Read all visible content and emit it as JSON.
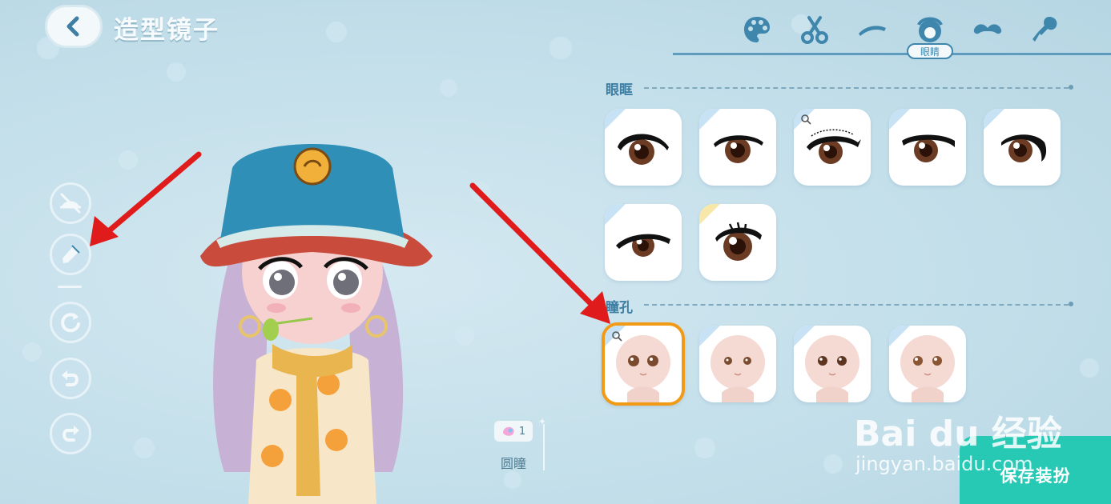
{
  "header": {
    "title": "造型镜子",
    "back_icon": "chevron-left-icon"
  },
  "tabs": {
    "items": [
      {
        "icon": "palette-icon"
      },
      {
        "icon": "scissors-icon"
      },
      {
        "icon": "eyebrow-icon"
      },
      {
        "icon": "eye-icon",
        "active": true,
        "label": "眼睛"
      },
      {
        "icon": "mustache-icon"
      },
      {
        "icon": "brush-icon"
      }
    ],
    "active_label": "眼睛"
  },
  "eye_frame": {
    "title": "眼眶",
    "options_count": 7
  },
  "pupil": {
    "title": "瞳孔",
    "options_count": 4,
    "selected_index": 0
  },
  "tools": [
    "hide-accessory-icon",
    "eyedropper-icon",
    "rotate-icon",
    "undo-icon",
    "redo-icon"
  ],
  "pupil_info": {
    "count": "1",
    "name": "圆瞳"
  },
  "save_label": "保存装扮",
  "watermark": {
    "main": "Bai du 经验",
    "sub": "jingyan.baidu.com"
  },
  "colors": {
    "accent": "#3f86ad",
    "selected_border": "#f19a16",
    "save_button": "#27c9b5",
    "annotation_arrow": "#e01b1b"
  }
}
